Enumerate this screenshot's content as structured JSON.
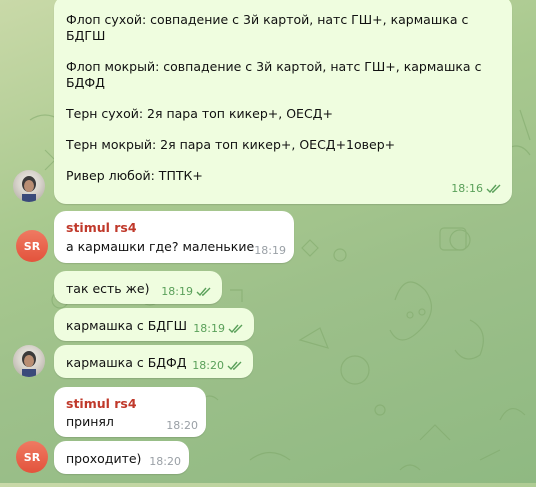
{
  "messages": [
    {
      "id": "m1",
      "text": "Флоп сухой: совпадение с 3й картой, натс ГШ+, кармашка с БДГШ\n\nФлоп мокрый: совпадение с 3й картой, натс ГШ+, кармашка с БДФД\n\nТерн сухой: 2я пара топ кикер+, ОЕСД+\n\nТерн мокрый: 2я пара топ кикер+, ОЕСД+1овер+\n\nРивер любой: ТПТК+",
      "time": "18:16"
    },
    {
      "id": "m2",
      "sender": "stimul rs4",
      "text": "а кармашки где? маленькие",
      "time": "18:19"
    },
    {
      "id": "m3",
      "text": "так есть же)",
      "time": "18:19"
    },
    {
      "id": "m4",
      "text": "кармашка с БДГШ",
      "time": "18:19"
    },
    {
      "id": "m5",
      "text": "кармашка с БДФД",
      "time": "18:20"
    },
    {
      "id": "m6",
      "sender": "stimul rs4",
      "text": "принял",
      "time": "18:20"
    },
    {
      "id": "m7",
      "text": "проходите)",
      "time": "18:20"
    }
  ],
  "avatars": {
    "sr_initials": "SR"
  },
  "colors": {
    "outgoing_bubble": "#effddf",
    "incoming_bubble": "#ffffff",
    "sender_name": "#c0392b",
    "check_marks": "#5aa05a"
  },
  "icons": [
    "double-check-icon",
    "user-photo-avatar",
    "sr-initials-avatar"
  ]
}
